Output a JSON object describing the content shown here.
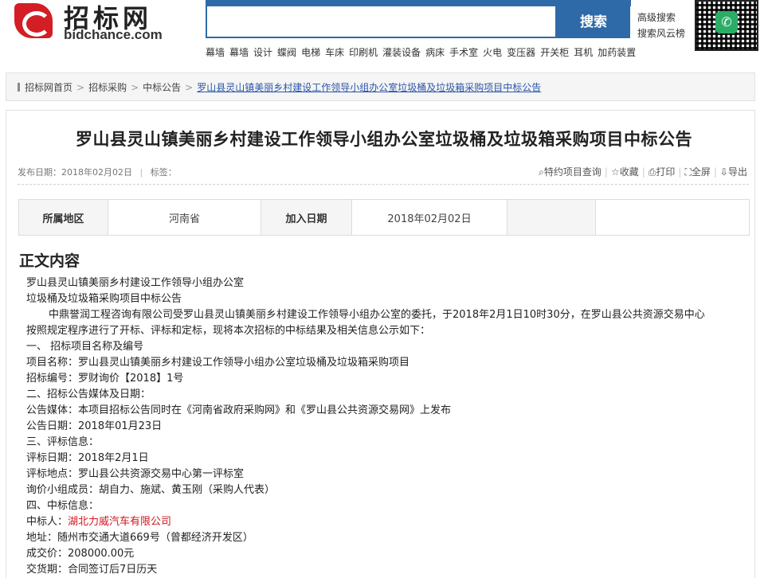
{
  "header": {
    "logo_cn": "招标网",
    "logo_en": "bidchance.com",
    "search_button": "搜索",
    "advanced_search": "高级搜索",
    "ranking": "搜索风云榜",
    "keywords": [
      "幕墙",
      "幕墙",
      "设计",
      "蝶阀",
      "电梯",
      "车床",
      "印刷机",
      "灌装设备",
      "病床",
      "手术室",
      "火电",
      "变压器",
      "开关柜",
      "耳机",
      "加药装置"
    ]
  },
  "breadcrumb": {
    "items": [
      "招标网首页",
      "招标采购",
      "中标公告"
    ],
    "current": "罗山县灵山镇美丽乡村建设工作领导小组办公室垃圾桶及垃圾箱采购项目中标公告"
  },
  "article": {
    "title": "罗山县灵山镇美丽乡村建设工作领导小组办公室垃圾桶及垃圾箱采购项目中标公告",
    "publish_label": "发布日期：2018年02月02日",
    "tags_label": "标签：",
    "tools": {
      "special": "特约项目查询",
      "favorite": "收藏",
      "print": "打印",
      "fullscreen": "全屏",
      "export": "导出"
    },
    "info": {
      "region_label": "所属地区",
      "region_value": "河南省",
      "date_label": "加入日期",
      "date_value": "2018年02月02日"
    },
    "section_title": "正文内容",
    "lines": [
      "罗山县灵山镇美丽乡村建设工作领导小组办公室",
      "垃圾桶及垃圾箱采购项目中标公告",
      "中鼎誉润工程咨询有限公司受罗山县灵山镇美丽乡村建设工作领导小组办公室的委托，于2018年2月1日10时30分，在罗山县公共资源交易中心",
      "按照规定程序进行了开标、评标和定标，现将本次招标的中标结果及相关信息公示如下：",
      "一、 招标项目名称及编号",
      "项目名称：罗山县灵山镇美丽乡村建设工作领导小组办公室垃圾桶及垃圾箱采购项目",
      "招标编号：罗财询价【2018】1号",
      "二、招标公告媒体及日期：",
      "公告媒体：本项目招标公告同时在《河南省政府采购网》和《罗山县公共资源交易网》上发布",
      "公告日期：2018年01月23日",
      "三、评标信息：",
      "评标日期：2018年2月1日",
      "评标地点：罗山县公共资源交易中心第一评标室",
      "询价小组成员：胡自力、施斌、黄玉刚（采购人代表）",
      "四、中标信息：",
      "中标人：",
      "湖北力威汽车有限公司",
      "地址：随州市交通大道669号（曾都经济开发区）",
      "成交价：208000.00元",
      "交货期：合同签订后7日历天"
    ]
  },
  "colors": {
    "brand_red": "#d21e24",
    "search_blue": "#2f6aa8",
    "link_blue": "#2b55a8",
    "winner_red": "#d0161c"
  }
}
